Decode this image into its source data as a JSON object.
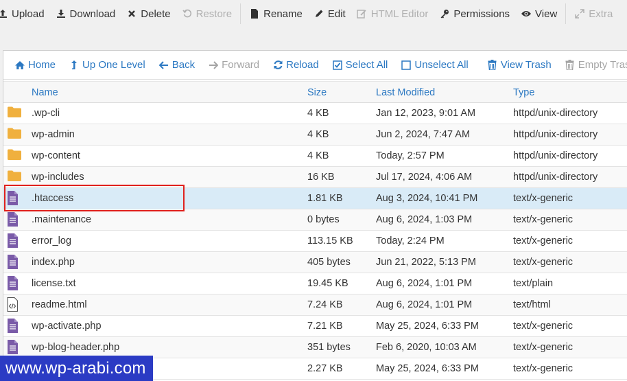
{
  "toolbar": {
    "items": [
      {
        "label": "Upload",
        "icon": "upload-icon",
        "disabled": false
      },
      {
        "label": "Download",
        "icon": "download-icon",
        "disabled": false
      },
      {
        "label": "Delete",
        "icon": "close-icon",
        "disabled": false
      },
      {
        "label": "Restore",
        "icon": "restore-icon",
        "disabled": true
      },
      {
        "label": "Rename",
        "icon": "file-icon",
        "disabled": false
      },
      {
        "label": "Edit",
        "icon": "pencil-icon",
        "disabled": false
      },
      {
        "label": "HTML Editor",
        "icon": "html-editor-icon",
        "disabled": true
      },
      {
        "label": "Permissions",
        "icon": "key-icon",
        "disabled": false
      },
      {
        "label": "View",
        "icon": "eye-icon",
        "disabled": false
      },
      {
        "label": "Extra",
        "icon": "expand-icon",
        "disabled": true
      }
    ]
  },
  "navbar": {
    "items": [
      {
        "label": "Home",
        "icon": "home-icon",
        "disabled": false
      },
      {
        "label": "Up One Level",
        "icon": "up-level-icon",
        "disabled": false
      },
      {
        "label": "Back",
        "icon": "arrow-left-icon",
        "disabled": false
      },
      {
        "label": "Forward",
        "icon": "arrow-right-icon",
        "disabled": true
      },
      {
        "label": "Reload",
        "icon": "reload-icon",
        "disabled": false
      },
      {
        "label": "Select All",
        "icon": "checkbox-checked-icon",
        "disabled": false
      },
      {
        "label": "Unselect All",
        "icon": "checkbox-empty-icon",
        "disabled": false
      },
      {
        "label": "View Trash",
        "icon": "trash-icon",
        "disabled": false
      },
      {
        "label": "Empty Trash",
        "icon": "trash-icon",
        "disabled": true
      }
    ]
  },
  "table": {
    "headers": {
      "name": "Name",
      "size": "Size",
      "modified": "Last Modified",
      "type": "Type"
    },
    "rows": [
      {
        "icon": "folder-icon",
        "name": ".wp-cli",
        "size": "4 KB",
        "modified": "Jan 12, 2023, 9:01 AM",
        "type": "httpd/unix-directory"
      },
      {
        "icon": "folder-icon",
        "name": "wp-admin",
        "size": "4 KB",
        "modified": "Jun 2, 2024, 7:47 AM",
        "type": "httpd/unix-directory"
      },
      {
        "icon": "folder-icon",
        "name": "wp-content",
        "size": "4 KB",
        "modified": "Today, 2:57 PM",
        "type": "httpd/unix-directory"
      },
      {
        "icon": "folder-icon",
        "name": "wp-includes",
        "size": "16 KB",
        "modified": "Jul 17, 2024, 4:06 AM",
        "type": "httpd/unix-directory"
      },
      {
        "icon": "text-file-icon",
        "name": ".htaccess",
        "size": "1.81 KB",
        "modified": "Aug 3, 2024, 10:41 PM",
        "type": "text/x-generic",
        "selected": true
      },
      {
        "icon": "text-file-icon",
        "name": ".maintenance",
        "size": "0 bytes",
        "modified": "Aug 6, 2024, 1:03 PM",
        "type": "text/x-generic"
      },
      {
        "icon": "text-file-icon",
        "name": "error_log",
        "size": "113.15 KB",
        "modified": "Today, 2:24 PM",
        "type": "text/x-generic"
      },
      {
        "icon": "text-file-icon",
        "name": "index.php",
        "size": "405 bytes",
        "modified": "Jun 21, 2022, 5:13 PM",
        "type": "text/x-generic"
      },
      {
        "icon": "text-file-icon",
        "name": "license.txt",
        "size": "19.45 KB",
        "modified": "Aug 6, 2024, 1:01 PM",
        "type": "text/plain"
      },
      {
        "icon": "code-file-icon",
        "name": "readme.html",
        "size": "7.24 KB",
        "modified": "Aug 6, 2024, 1:01 PM",
        "type": "text/html"
      },
      {
        "icon": "text-file-icon",
        "name": "wp-activate.php",
        "size": "7.21 KB",
        "modified": "May 25, 2024, 6:33 PM",
        "type": "text/x-generic"
      },
      {
        "icon": "text-file-icon",
        "name": "wp-blog-header.php",
        "size": "351 bytes",
        "modified": "Feb 6, 2020, 10:03 AM",
        "type": "text/x-generic"
      },
      {
        "icon": "text-file-icon",
        "name": "",
        "size": "2.27 KB",
        "modified": "May 25, 2024, 6:33 PM",
        "type": "text/x-generic"
      }
    ]
  },
  "watermark": "www.wp-arabi.com",
  "colors": {
    "link": "#2b78c2",
    "folder": "#f0b03e",
    "file": "#7a5ba8",
    "selected_row": "#d9ebf7",
    "highlight": "#e0201c",
    "watermark_bg": "#2b3bc4"
  }
}
